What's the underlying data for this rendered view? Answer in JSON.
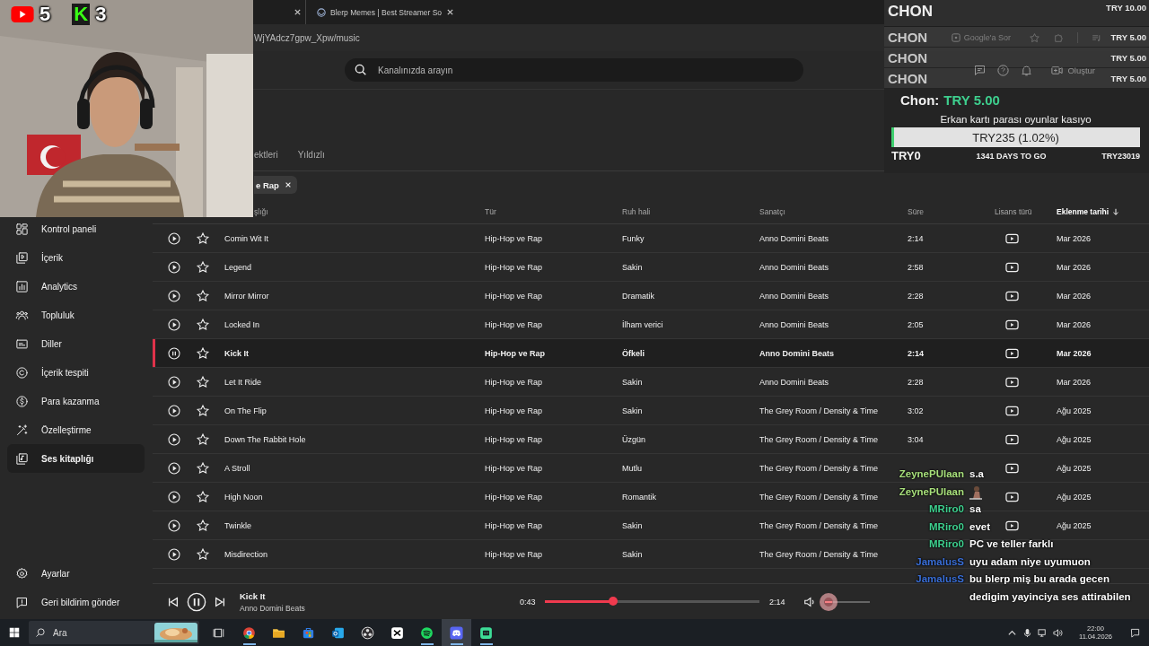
{
  "webcam_overlay": {
    "counters": [
      {
        "kind": "red_play",
        "count": "5"
      },
      {
        "kind": "green_letter",
        "label": "K",
        "count": "3"
      }
    ]
  },
  "browser": {
    "tabs": [
      {
        "kind": "covered"
      },
      {
        "kind": "page",
        "title": "Blerp Memes | Best Streamer So"
      }
    ],
    "url": "WjYAdcz7gpw_Xpw/music",
    "ask_button": "Google'a Sor"
  },
  "header": {
    "search": {
      "placeholder": "Kanalınızda arayın"
    },
    "create_button": "Oluştur"
  },
  "sidebar": {
    "items": [
      {
        "label": "Kontrol paneli",
        "selected": false
      },
      {
        "label": "İçerik",
        "selected": false
      },
      {
        "label": "Analytics",
        "selected": false
      },
      {
        "label": "Topluluk",
        "selected": false
      },
      {
        "label": "Diller",
        "selected": false
      },
      {
        "label": "İçerik tespiti",
        "selected": false
      },
      {
        "label": "Para kazanma",
        "selected": false
      },
      {
        "label": "Özelleştirme",
        "selected": false
      },
      {
        "label": "Ses kitaplığı",
        "selected": true
      }
    ],
    "bottom_items": [
      {
        "label": "Ayarlar"
      },
      {
        "label": "Geri bildirim gönder"
      }
    ]
  },
  "page_tabs": [
    {
      "label": "ektleri",
      "selected": false
    },
    {
      "label": "Yıldızlı",
      "selected": false
    }
  ],
  "filter_chip": "e Rap",
  "table": {
    "columns": [
      {
        "label": "şlığı",
        "sorted": false
      },
      {
        "label": "Tür",
        "sorted": false
      },
      {
        "label": "Ruh hali",
        "sorted": false
      },
      {
        "label": "Sanatçı",
        "sorted": false
      },
      {
        "label": "Süre",
        "sorted": false
      },
      {
        "label": "Lisans türü",
        "sorted": false
      },
      {
        "label": "Eklenme tarihi",
        "sorted": true
      }
    ],
    "rows": [
      {
        "playing": false,
        "starred": false,
        "title": "Comin Wit It",
        "genre": "Hip-Hop ve Rap",
        "mood": "Funky",
        "artist": "Anno Domini Beats",
        "duration": "2:14",
        "date": "Mar 2026"
      },
      {
        "playing": false,
        "starred": false,
        "title": "Legend",
        "genre": "Hip-Hop ve Rap",
        "mood": "Sakin",
        "artist": "Anno Domini Beats",
        "duration": "2:58",
        "date": "Mar 2026"
      },
      {
        "playing": false,
        "starred": false,
        "title": "Mirror Mirror",
        "genre": "Hip-Hop ve Rap",
        "mood": "Dramatik",
        "artist": "Anno Domini Beats",
        "duration": "2:28",
        "date": "Mar 2026"
      },
      {
        "playing": false,
        "starred": false,
        "title": "Locked In",
        "genre": "Hip-Hop ve Rap",
        "mood": "İlham verici",
        "artist": "Anno Domini Beats",
        "duration": "2:05",
        "date": "Mar 2026"
      },
      {
        "playing": true,
        "starred": false,
        "title": "Kick It",
        "genre": "Hip-Hop ve Rap",
        "mood": "Öfkeli",
        "artist": "Anno Domini Beats",
        "duration": "2:14",
        "date": "Mar 2026"
      },
      {
        "playing": false,
        "starred": false,
        "title": "Let It Ride",
        "genre": "Hip-Hop ve Rap",
        "mood": "Sakin",
        "artist": "Anno Domini Beats",
        "duration": "2:28",
        "date": "Mar 2026"
      },
      {
        "playing": false,
        "starred": false,
        "title": "On The Flip",
        "genre": "Hip-Hop ve Rap",
        "mood": "Sakin",
        "artist": "The Grey Room / Density & Time",
        "duration": "3:02",
        "date": "Ağu 2025"
      },
      {
        "playing": false,
        "starred": false,
        "title": "Down The Rabbit Hole",
        "genre": "Hip-Hop ve Rap",
        "mood": "Üzgün",
        "artist": "The Grey Room / Density & Time",
        "duration": "3:04",
        "date": "Ağu 2025"
      },
      {
        "playing": false,
        "starred": false,
        "title": "A Stroll",
        "genre": "Hip-Hop ve Rap",
        "mood": "Mutlu",
        "artist": "The Grey Room / Density & Time",
        "date": "Ağu 2025"
      },
      {
        "playing": false,
        "starred": false,
        "title": "High Noon",
        "genre": "Hip-Hop ve Rap",
        "mood": "Romantik",
        "artist": "The Grey Room / Density & Time",
        "date": "Ağu 2025"
      },
      {
        "playing": false,
        "starred": false,
        "title": "Twinkle",
        "genre": "Hip-Hop ve Rap",
        "mood": "Sakin",
        "artist": "The Grey Room / Density & Time",
        "date": "Ağu 2025"
      },
      {
        "playing": false,
        "starred": false,
        "title": "Misdirection",
        "genre": "Hip-Hop ve Rap",
        "mood": "Sakin",
        "artist": "The Grey Room / Density & Time"
      }
    ]
  },
  "player": {
    "playing": true,
    "title": "Kick It",
    "artist": "Anno Domini Beats",
    "elapsed": "0:43",
    "total": "2:14",
    "level": 0.32,
    "volume": {
      "level": 0.15
    }
  },
  "taskbar": {
    "search_placeholder": "Ara",
    "apps": [
      {
        "kind": "taskview",
        "running": false,
        "active": false
      },
      {
        "kind": "chrome",
        "running": true,
        "active": false
      },
      {
        "kind": "folder",
        "running": false,
        "active": false
      },
      {
        "kind": "store",
        "running": false,
        "active": false
      },
      {
        "kind": "mail",
        "running": false,
        "active": false
      },
      {
        "kind": "obs",
        "running": false,
        "active": false
      },
      {
        "kind": "capcut",
        "running": false,
        "active": false
      },
      {
        "kind": "spotify",
        "running": true,
        "active": false
      },
      {
        "kind": "discord",
        "running": true,
        "active": true
      },
      {
        "kind": "chat",
        "running": true,
        "active": false
      }
    ],
    "time": "22:00",
    "date": "11.04.2026"
  },
  "donations": {
    "feed": [
      {
        "name": "CHON",
        "amount": "TRY 10.00"
      },
      {
        "name": "CHON",
        "amount": "TRY 5.00"
      },
      {
        "name": "CHON",
        "amount": "TRY 5.00"
      },
      {
        "name": "CHON",
        "amount": "TRY 5.00"
      }
    ],
    "latest": {
      "name": "Chon:",
      "amount": "TRY 5.00"
    },
    "goal": {
      "title": "Erkan kartı parası oyunlar kasıyo",
      "reading": "TRY235 (1.02%)",
      "level": 0.0102,
      "start": "TRY0",
      "remaining": "1341 DAYS TO GO",
      "target": "TRY23019"
    }
  },
  "chat": [
    {
      "user": "ZeynePUlaan",
      "color": "#a8e07c",
      "kind": "text",
      "message": "s.a"
    },
    {
      "user": "ZeynePUlaan",
      "color": "#a8e07c",
      "kind": "emote"
    },
    {
      "user": "MRiro0",
      "color": "#3ecf8e",
      "kind": "text",
      "message": "sa"
    },
    {
      "user": "MRiro0",
      "color": "#3ecf8e",
      "kind": "text",
      "message": "evet"
    },
    {
      "user": "MRiro0",
      "color": "#3ecf8e",
      "kind": "text",
      "message": "PC ve teller farklı"
    },
    {
      "user": "JamalusS",
      "color": "#3a6fd8",
      "kind": "text",
      "message": "uyu adam niye uyumuon"
    },
    {
      "user": "JamalusS",
      "color": "#3a6fd8",
      "kind": "text",
      "message": "bu blerp miş bu arada gecen dedigim yayinciya ses attirabilen"
    }
  ]
}
